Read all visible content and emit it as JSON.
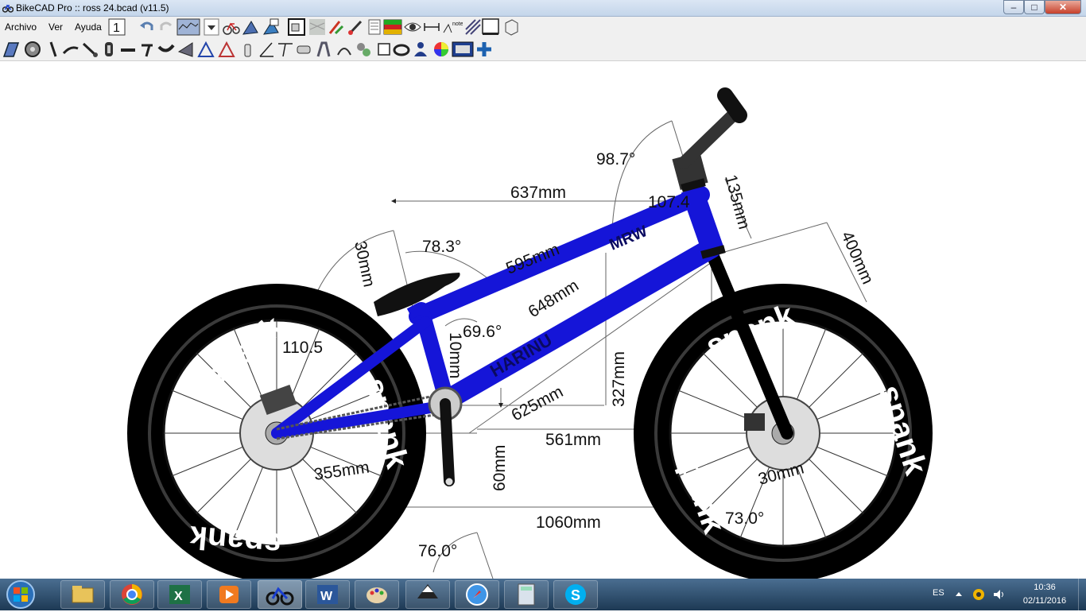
{
  "window": {
    "title": "BikeCAD Pro :: ross 24.bcad (v11.5)",
    "minimize_label": "–",
    "maximize_label": "□",
    "close_label": "✕"
  },
  "menu": {
    "items": [
      "Archivo",
      "Ver",
      "Ayuda"
    ]
  },
  "toolbar_icons_row1": [
    "page-1-icon",
    "undo-icon",
    "redo-icon",
    "graph-icon",
    "dropdown-icon",
    "bike-icon",
    "frame-icon",
    "frame-color-icon",
    "layers-icon",
    "texture-icon",
    "pen-icon",
    "paint-icon",
    "notes-icon",
    "flag-icon",
    "eye-icon",
    "dimension-icon",
    "note-dimension-icon",
    "shading-icon",
    "blank-icon",
    "box-icon"
  ],
  "toolbar_icons_row2": [
    "frame-tool-icon",
    "wheel-icon",
    "fork-icon",
    "handlebar-icon",
    "crank-icon",
    "chainring-icon",
    "stem-icon",
    "seatpost-icon",
    "saddle-icon",
    "frame-triangle-icon",
    "frame-outline-icon",
    "bottle-icon",
    "angle-icon",
    "tee-icon",
    "tool-icon",
    "fender-icon",
    "rack-icon",
    "derailleur-icon",
    "square-icon",
    "bag-icon",
    "rider-icon",
    "color-wheel-icon",
    "display-icon",
    "plus-icon"
  ],
  "drawing": {
    "brand_label": "spank",
    "top_tube_label": "MRW",
    "down_tube_label": "HARINU",
    "dimensions": {
      "head_angle": "98.7°",
      "reach_top": "637mm",
      "head_tube_length": "135mm",
      "head_angle_partial": "107.4",
      "fork_length": "400mm",
      "seat_post_offset": "30mm",
      "seat_angle": "78.3°",
      "top_tube": "595mm",
      "down_tube": "648mm",
      "angle_inner": "69.6°",
      "angle_left": "110.5",
      "seat_tube_small": "10mm",
      "stack": "327mm",
      "effective": "625mm",
      "front_center": "561mm",
      "chainstay": "355mm",
      "bb_drop": "60mm",
      "wheelbase": "1060mm",
      "fork_offset": "30mm",
      "front_angle": "73.0°",
      "crank_angle": "76.0°"
    }
  },
  "taskbar": {
    "apps": [
      "explorer-icon",
      "chrome-icon",
      "excel-icon",
      "media-player-icon",
      "bikecad-icon",
      "word-icon",
      "paint-icon",
      "inkscape-icon",
      "safari-icon",
      "calculator-icon",
      "skype-icon"
    ],
    "language": "ES",
    "time": "10:36",
    "date": "02/11/2016"
  }
}
